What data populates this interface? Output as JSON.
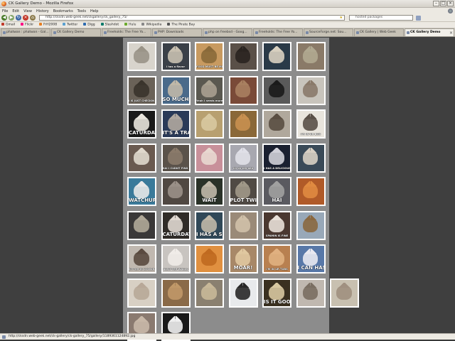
{
  "window": {
    "title": "CK Gallery Demo - Mozilla Firefox"
  },
  "menu": [
    "File",
    "Edit",
    "View",
    "History",
    "Bookmarks",
    "Tools",
    "Help"
  ],
  "nav": {
    "url": "http://cksdn.web-geek.net/ckgallery/ck_gallery_75/",
    "search_placeholder": "hosted packages"
  },
  "bookmarks": [
    {
      "label": "Gmail",
      "color": "#c0392b"
    },
    {
      "label": "Flickr",
      "color": "#ff0084"
    },
    {
      "label": "FrH2008",
      "color": "#e67e22"
    },
    {
      "label": "Twitter",
      "color": "#5aa0d0"
    },
    {
      "label": "Digg",
      "color": "#2d6bb0"
    },
    {
      "label": "Slashdot",
      "color": "#0a7a6a"
    },
    {
      "label": "Hulu",
      "color": "#6aaa2a"
    },
    {
      "label": "Wikipedia",
      "color": "#888888"
    },
    {
      "label": "The Pirate Bay",
      "color": "#555555"
    }
  ],
  "tabs": [
    {
      "label": "phatwan : phatwan - Gal...",
      "active": false
    },
    {
      "label": "CK Gallery Demo",
      "active": false
    },
    {
      "label": "Freeholds: The Free Yo...",
      "active": false
    },
    {
      "label": "PHP: Downloads",
      "active": false
    },
    {
      "label": "php on freebsd - Goog...",
      "active": false
    },
    {
      "label": "Freeholds: The Free Yo...",
      "active": false
    },
    {
      "label": "SourceForge.net: Sou...",
      "active": false
    },
    {
      "label": "CK Gallery | Web Geek",
      "active": false
    },
    {
      "label": "CK Gallery Demo",
      "active": true
    }
  ],
  "thumbs": [
    {
      "bg": "#d8d4cc",
      "cat": "#9a9488",
      "caption": ""
    },
    {
      "bg": "#3a4048",
      "cat": "#c8c0b0",
      "caption": "i has a flavor"
    },
    {
      "bg": "#c89a60",
      "cat": "#8a6a3a",
      "caption": "FOOD MUST BE MINE"
    },
    {
      "bg": "#5a5048",
      "cat": "#2a2420",
      "caption": ""
    },
    {
      "bg": "#2a3a48",
      "cat": "#d8d0c0",
      "caption": ""
    },
    {
      "bg": "#8a7a68",
      "cat": "#b0a890",
      "caption": ""
    },
    {
      "bg": "#6a6258",
      "cat": "#3a342c",
      "caption": "I IS JUST CHECKIN IN ON U"
    },
    {
      "bg": "#4a6a8a",
      "cat": "#c0b8a8",
      "caption": "SO MUCH"
    },
    {
      "bg": "#5a5850",
      "cat": "#a8a090",
      "caption": "Yeah I needs more monies"
    },
    {
      "bg": "#7a4a38",
      "cat": "#a88060",
      "caption": ""
    },
    {
      "bg": "#5a5a5a",
      "cat": "#1a1a1a",
      "caption": ""
    },
    {
      "bg": "#c8c4bc",
      "cat": "#8a7a6a",
      "caption": ""
    },
    {
      "bg": "#1a1a1a",
      "cat": "#e8e4dc",
      "caption": "CATURDAY"
    },
    {
      "bg": "#2a3a58",
      "cat": "#b0a8a0",
      "caption": "IT'S A TRAP"
    },
    {
      "bg": "#b8a070",
      "cat": "#d8c8a0",
      "caption": ""
    },
    {
      "bg": "#8a6838",
      "cat": "#c89050",
      "caption": ""
    },
    {
      "bg": "#b0a89c",
      "cat": "#5a4e42",
      "caption": ""
    },
    {
      "bg": "#e8e4dc",
      "cat": "#5a5048",
      "caption": "I'M IN UR BOX"
    },
    {
      "bg": "#6a5a50",
      "cat": "#e0d8cc",
      "caption": ""
    },
    {
      "bg": "#5a524a",
      "cat": "#8a7a6a",
      "caption": "HAI I CUDNT FIND UR BATHROOM"
    },
    {
      "bg": "#c8909a",
      "cat": "#e8d8d0",
      "caption": ""
    },
    {
      "bg": "#a8a8b0",
      "cat": "#e0e0e8",
      "caption": "im on teh bed"
    },
    {
      "bg": "#1a2030",
      "cat": "#d0d0d8",
      "caption": "I HAS A DELICIOUS TEE"
    },
    {
      "bg": "#3a4a58",
      "cat": "#d8d0c4",
      "caption": ""
    },
    {
      "bg": "#3a7a9a",
      "cat": "#e8e8e8",
      "caption": "WATCHUR DOIN"
    },
    {
      "bg": "#504842",
      "cat": "#9a9088",
      "caption": ""
    },
    {
      "bg": "#2a3228",
      "cat": "#c0b8a8",
      "caption": "WAIT"
    },
    {
      "bg": "#504a44",
      "cat": "#a09888",
      "caption": "PLOT TWIST"
    },
    {
      "bg": "#5a5a60",
      "cat": "#a0a0a0",
      "caption": "HAI"
    },
    {
      "bg": "#b05a28",
      "cat": "#e08a40",
      "caption": ""
    },
    {
      "bg": "#3a3838",
      "cat": "#b0a898",
      "caption": ""
    },
    {
      "bg": "#302c28",
      "cat": "#e0d8d0",
      "caption": "CATURDAY"
    },
    {
      "bg": "#304858",
      "cat": "#c0b8a8",
      "caption": "I HAS A SAD"
    },
    {
      "bg": "#9a8a78",
      "cat": "#d0c0a8",
      "caption": ""
    },
    {
      "bg": "#4a3830",
      "cat": "#e8e0d8",
      "caption": "SPAMIN IS FINE"
    },
    {
      "bg": "#98a8b8",
      "cat": "#8a6840",
      "caption": ""
    },
    {
      "bg": "#c0b8b0",
      "cat": "#5a4a40",
      "caption": "KITTEH IS LOOKIN UR SAMWICH"
    },
    {
      "bg": "#c8c4c0",
      "cat": "#f0ece8",
      "caption": "ALSO TEH WALLS"
    },
    {
      "bg": "#e09040",
      "cat": "#c06a20",
      "caption": ""
    },
    {
      "bg": "#a88868",
      "cat": "#e0c8a0",
      "caption": "MOAR!"
    },
    {
      "bg": "#b88050",
      "cat": "#e0b080",
      "caption": "I'M IN UR TUBS"
    },
    {
      "bg": "#5878a8",
      "cat": "#e8e8f0",
      "caption": "I CAN HAS"
    },
    {
      "bg": "#d8d0c4",
      "cat": "#b8a898",
      "caption": ""
    },
    {
      "bg": "#8a6a48",
      "cat": "#c09868",
      "caption": ""
    },
    {
      "bg": "#8a8070",
      "cat": "#c8b898",
      "caption": ""
    },
    {
      "bg": "#e8eaec",
      "cat": "#282828",
      "caption": ""
    },
    {
      "bg": "#3a3020",
      "cat": "#d8c8a0",
      "caption": "IS IT GOOD"
    },
    {
      "bg": "#c0b8b0",
      "cat": "#7a6e62",
      "caption": ""
    },
    {
      "bg": "#c8c0b0",
      "cat": "#a09080",
      "caption": ""
    },
    {
      "bg": "#8a7a70",
      "cat": "#c8b8a8",
      "caption": ""
    },
    {
      "bg": "#1a1a1a",
      "cat": "#f0f0f0",
      "caption": ""
    }
  ],
  "status": {
    "text": "http://cksdn.web-geek.net/ck-gallery/ck-gallery_75/gallery/1189361124892.jpg"
  }
}
